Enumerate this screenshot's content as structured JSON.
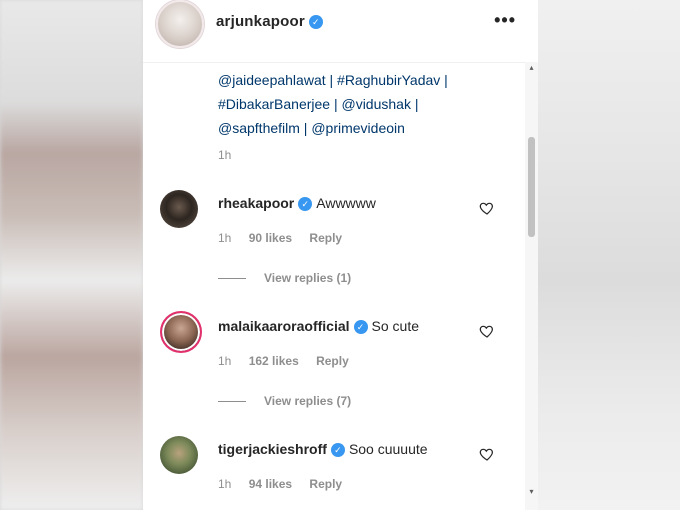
{
  "post": {
    "username": "arjunkapoor",
    "more_icon": "more-icon",
    "caption_lines": [
      "@jaideepahlawat | #RaghubirYadav |",
      "#DibakarBanerjee | @vidushak |",
      "@sapfthefilm | @primevideoin"
    ],
    "caption_time": "1h"
  },
  "comments": [
    {
      "username": "rheakapoor",
      "text": "Awwwww",
      "time": "1h",
      "likes": "90 likes",
      "reply_label": "Reply",
      "view_replies": "View replies (1)"
    },
    {
      "username": "malaikaaroraofficial",
      "text": "So cute",
      "time": "1h",
      "likes": "162 likes",
      "reply_label": "Reply",
      "view_replies": "View replies (7)"
    },
    {
      "username": "tigerjackieshroff",
      "text": "Soo cuuuute",
      "time": "1h",
      "likes": "94 likes",
      "reply_label": "Reply"
    }
  ],
  "colors": {
    "link": "#00376b",
    "verified": "#3897f0",
    "muted": "#8e8e8e",
    "text": "#262626"
  }
}
